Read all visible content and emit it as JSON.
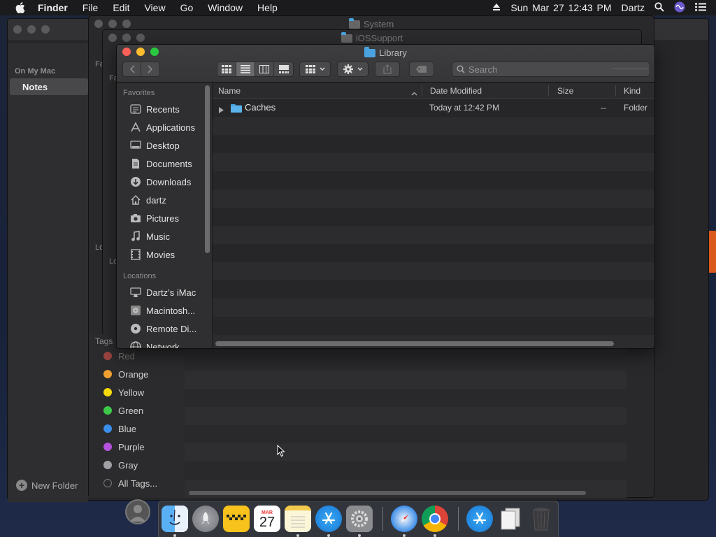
{
  "menubar": {
    "app": "Finder",
    "items": [
      "File",
      "Edit",
      "View",
      "Go",
      "Window",
      "Help"
    ],
    "clock": "Sun Mar 27  12:43 PM",
    "user": "Dartz"
  },
  "background_windows": {
    "system_title": "System",
    "iossupport_title": "iOSSupport",
    "sidebar_section": "On My Mac",
    "sidebar_selected": "Notes",
    "partial_labels": [
      "Fa",
      "Fa",
      "Lo",
      "Lo"
    ],
    "new_folder": "New Folder",
    "tags_header": "Tags",
    "tags": [
      {
        "label": "Red",
        "color": "#e5534b"
      },
      {
        "label": "Orange",
        "color": "#f0a030"
      },
      {
        "label": "Yellow",
        "color": "#f5d90a"
      },
      {
        "label": "Green",
        "color": "#3ec94a"
      },
      {
        "label": "Blue",
        "color": "#3b8eea"
      },
      {
        "label": "Purple",
        "color": "#b552de"
      },
      {
        "label": "Gray",
        "color": "#a0a0a5"
      },
      {
        "label": "All Tags...",
        "color": ""
      }
    ]
  },
  "finder": {
    "title": "Library",
    "search_placeholder": "Search",
    "sidebar": {
      "favorites_header": "Favorites",
      "favorites": [
        {
          "label": "Recents",
          "icon": "recents-icon"
        },
        {
          "label": "Applications",
          "icon": "applications-icon"
        },
        {
          "label": "Desktop",
          "icon": "desktop-icon"
        },
        {
          "label": "Documents",
          "icon": "documents-icon"
        },
        {
          "label": "Downloads",
          "icon": "downloads-icon"
        },
        {
          "label": "dartz",
          "icon": "home-icon"
        },
        {
          "label": "Pictures",
          "icon": "pictures-icon"
        },
        {
          "label": "Music",
          "icon": "music-icon"
        },
        {
          "label": "Movies",
          "icon": "movies-icon"
        }
      ],
      "locations_header": "Locations",
      "locations": [
        {
          "label": "Dartz’s iMac",
          "icon": "imac-icon"
        },
        {
          "label": "Macintosh...",
          "icon": "disk-icon"
        },
        {
          "label": "Remote Di...",
          "icon": "remote-disc-icon"
        },
        {
          "label": "Network",
          "icon": "network-icon"
        }
      ]
    },
    "columns": {
      "name": "Name",
      "date": "Date Modified",
      "size": "Size",
      "kind": "Kind"
    },
    "rows": [
      {
        "name": "Caches",
        "date": "Today at 12:42 PM",
        "size": "--",
        "kind": "Folder"
      }
    ]
  },
  "dock": {
    "apps": [
      {
        "name": "Finder",
        "icon": "finder-icon",
        "running": true
      },
      {
        "name": "Launchpad",
        "icon": "launchpad-icon",
        "running": false
      },
      {
        "name": "Taxi",
        "icon": "taxi-icon",
        "running": false
      },
      {
        "name": "Calendar",
        "icon": "calendar-icon",
        "running": false,
        "month": "MAR",
        "day": "27"
      },
      {
        "name": "Notes",
        "icon": "notes-icon",
        "running": true
      },
      {
        "name": "App Store",
        "icon": "app-store-icon",
        "running": true
      },
      {
        "name": "System Preferences",
        "icon": "system-preferences-icon",
        "running": true
      },
      {
        "name": "Safari",
        "icon": "safari-icon",
        "running": true
      },
      {
        "name": "Chrome",
        "icon": "chrome-icon",
        "running": true
      },
      {
        "name": "App Store Folder",
        "icon": "app-store-folder-icon",
        "running": false
      },
      {
        "name": "Documents Stack",
        "icon": "documents-stack-icon",
        "running": false
      },
      {
        "name": "Trash",
        "icon": "trash-icon",
        "running": false
      }
    ]
  }
}
